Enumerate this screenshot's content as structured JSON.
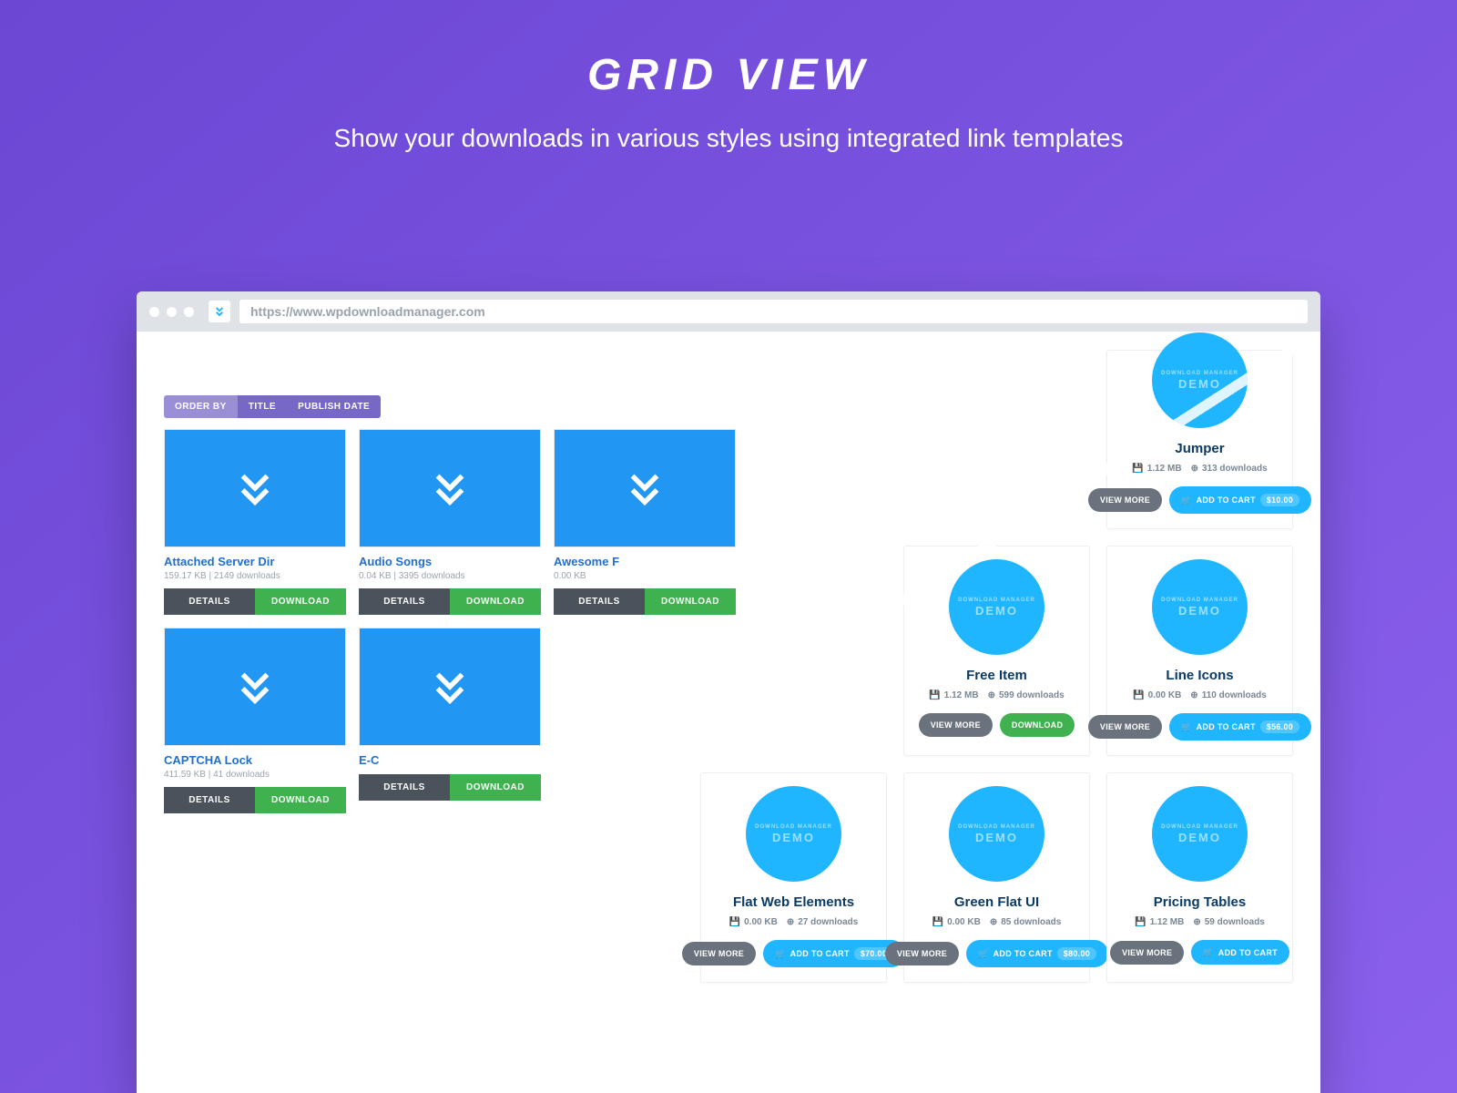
{
  "hero": {
    "title": "GRID VIEW",
    "subtitle": "Show your downloads in various styles using integrated link templates"
  },
  "browser": {
    "url": "https://www.wpdownloadmanager.com"
  },
  "orderbar": {
    "label": "ORDER BY",
    "opt1": "TITLE",
    "opt2": "PUBLISH DATE"
  },
  "labels": {
    "details": "DETAILS",
    "download": "DOWNLOAD",
    "view_more": "VIEW MORE",
    "add_to_cart": "ADD TO CART",
    "circle_top": "DOWNLOAD MANAGER",
    "circle_bottom": "DEMO"
  },
  "styleA": [
    {
      "title": "Attached Server Dir",
      "meta": "159.17 KB | 2149 downloads"
    },
    {
      "title": "Audio Songs",
      "meta": "0.04 KB | 3395 downloads"
    },
    {
      "title": "Awesome F",
      "meta": "0.00 KB"
    },
    {
      "title": "CAPTCHA Lock",
      "meta": "411.59 KB | 41 downloads"
    },
    {
      "title": "E-C",
      "meta": ""
    }
  ],
  "styleB": [
    {
      "title": "Jumper",
      "size": "1.12 MB",
      "downloads": "313 downloads",
      "action": "cart",
      "price": "$10.00",
      "topcut": true
    },
    {
      "title": "Free Item",
      "size": "1.12 MB",
      "downloads": "599 downloads",
      "action": "download"
    },
    {
      "title": "Line Icons",
      "size": "0.00 KB",
      "downloads": "110 downloads",
      "action": "cart",
      "price": "$56.00"
    },
    {
      "title": "Flat Web Elements",
      "size": "0.00 KB",
      "downloads": "27 downloads",
      "action": "cart",
      "price": "$70.00",
      "leftcut": true
    },
    {
      "title": "Green Flat UI",
      "size": "0.00 KB",
      "downloads": "85 downloads",
      "action": "cart",
      "price": "$80.00"
    },
    {
      "title": "Pricing Tables",
      "size": "1.12 MB",
      "downloads": "59 downloads",
      "action": "cart",
      "price": ""
    }
  ]
}
